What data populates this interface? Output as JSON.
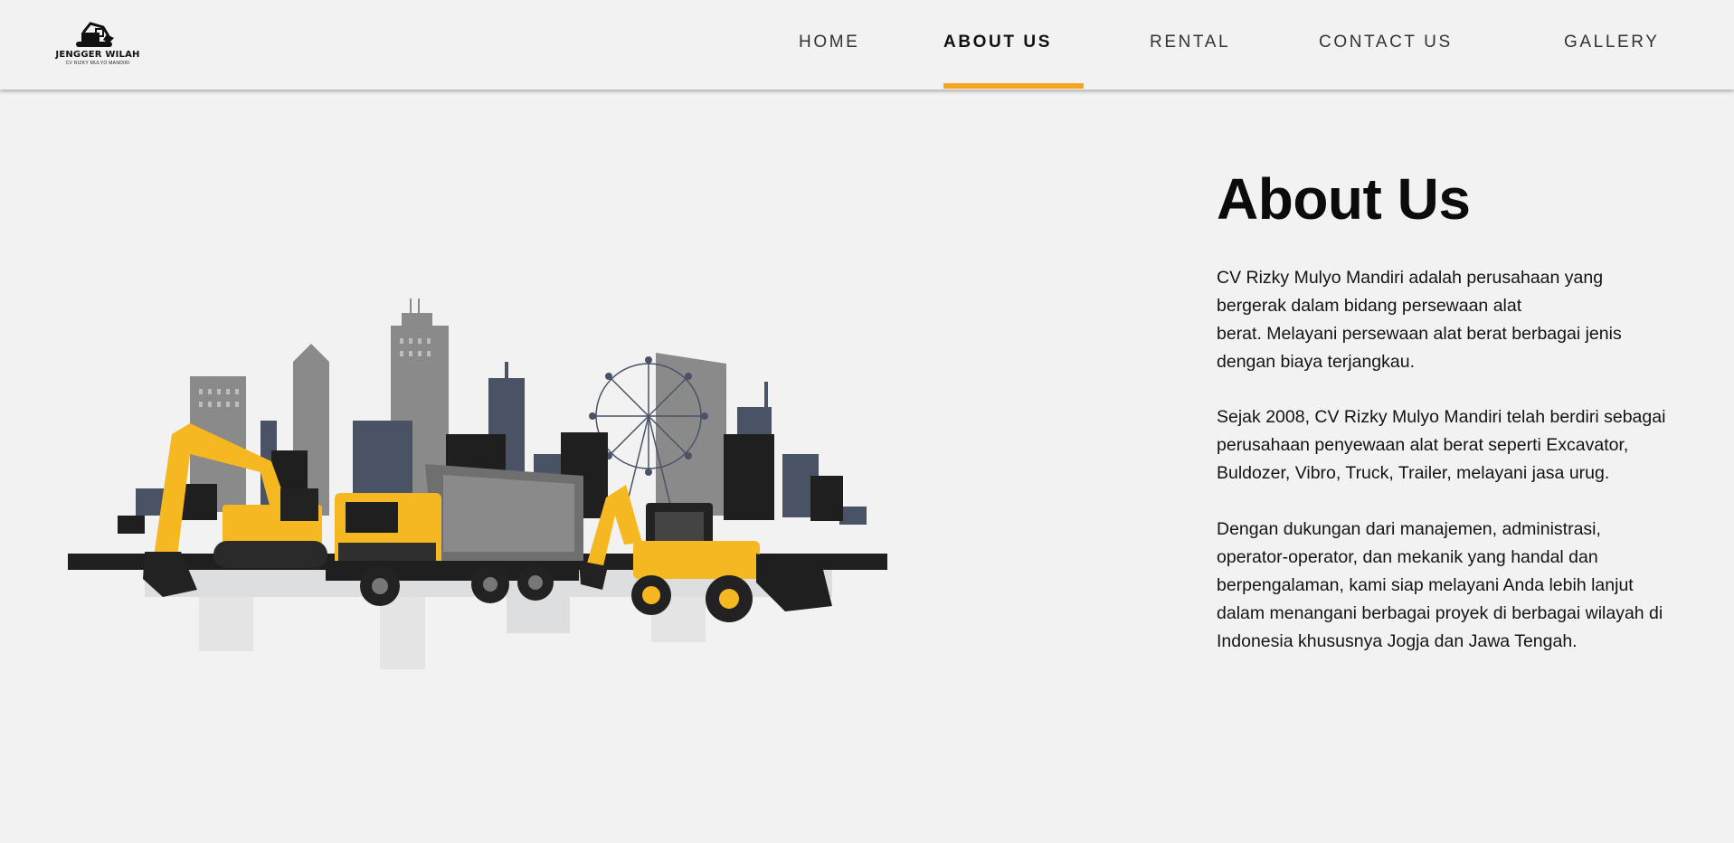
{
  "logo": {
    "name": "JENGGER WILAH",
    "subtitle": "CV RIZKY MULYO MANDIRI",
    "icon": "excavator-icon"
  },
  "nav": {
    "items": [
      "HOME",
      "ABOUT US",
      "RENTAL",
      "CONTACT US",
      "GALLERY"
    ],
    "active": "ABOUT US"
  },
  "colors": {
    "accent": "#f7a51c",
    "background": "#f2f2f2",
    "machine_yellow": "#f5b820",
    "building_dark": "#1f1f1f",
    "building_slate": "#4a5366",
    "building_gray": "#8a8a8a"
  },
  "hero": {
    "image": "heavy-equipment-city-illustration"
  },
  "about": {
    "title": "About Us",
    "paragraphs": [
      [
        "CV Rizky Mulyo Mandiri adalah perusahaan yang",
        "bergerak dalam bidang persewaan alat",
        "berat. Melayani persewaan alat berat berbagai jenis",
        "dengan biaya terjangkau."
      ],
      [
        "Sejak 2008, CV Rizky Mulyo Mandiri telah berdiri sebagai",
        "perusahaan penyewaan alat berat seperti Excavator,",
        "Buldozer, Vibro, Truck, Trailer, melayani jasa urug."
      ],
      [
        "Dengan dukungan dari manajemen, administrasi,",
        "operator-operator, dan mekanik yang handal dan",
        "berpengalaman, kami siap melayani Anda lebih lanjut",
        "dalam menangani berbagai proyek di berbagai wilayah di",
        "Indonesia khususnya Jogja dan Jawa Tengah."
      ]
    ]
  }
}
